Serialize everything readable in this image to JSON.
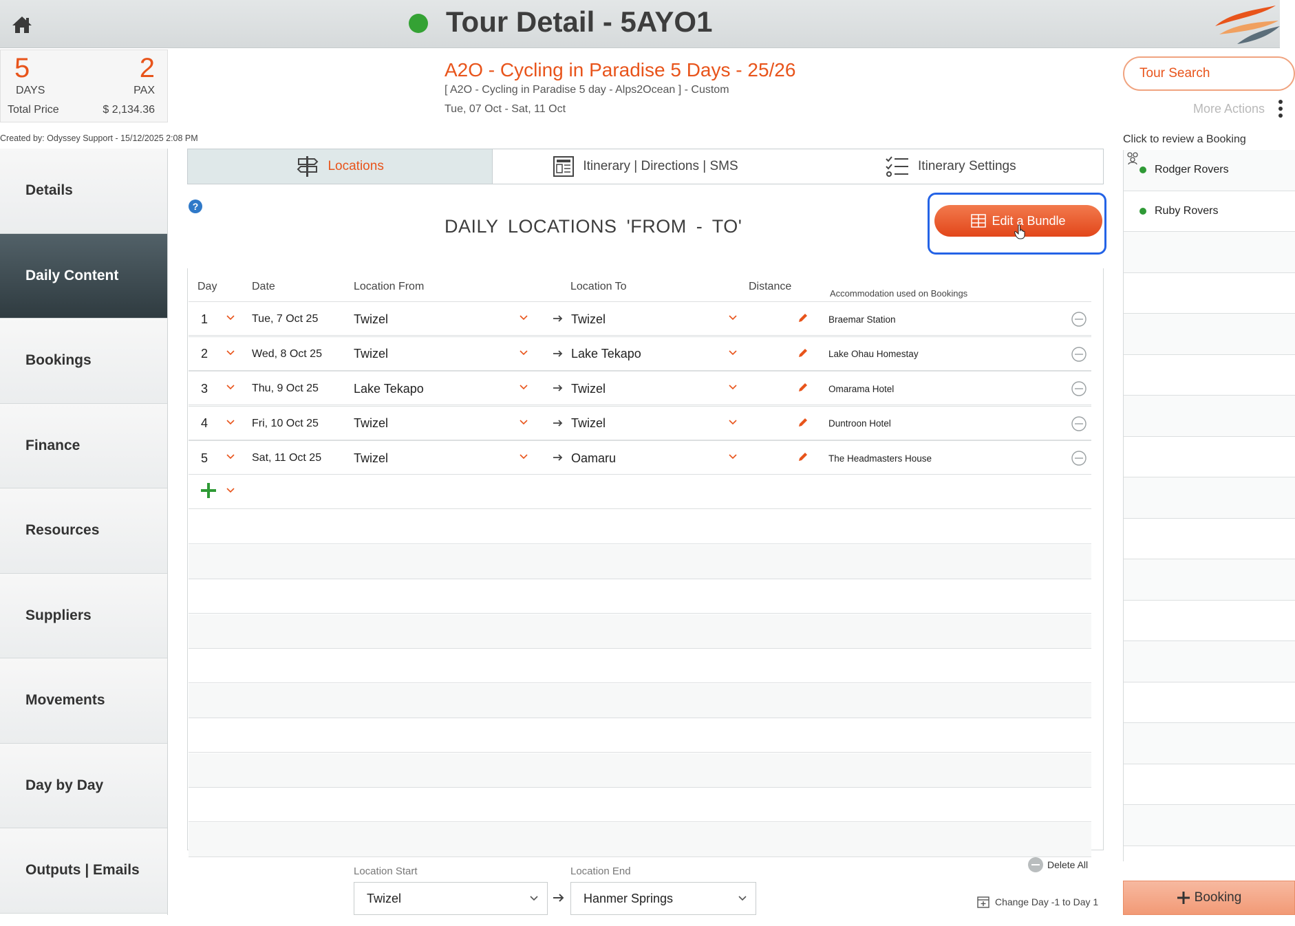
{
  "header": {
    "title": "Tour Detail - 5AYO1",
    "status_color": "#34a234"
  },
  "summary": {
    "days_value": "5",
    "days_label": "DAYS",
    "pax_value": "2",
    "pax_label": "PAX",
    "price_label": "Total Price",
    "price_value": "$ 2,134.36",
    "created": "Created by: Odyssey Support - 15/12/2025 2:08 PM"
  },
  "tour": {
    "title": "A2O - Cycling in Paradise 5 Days - 25/26",
    "subtitle": "[ A2O - Cycling in Paradise 5 day - Alps2Ocean ] - Custom",
    "dates": "Tue, 07 Oct  - Sat, 11 Oct"
  },
  "actions": {
    "tour_search": "Tour Search",
    "more_actions": "More Actions"
  },
  "sidebar": {
    "items": [
      {
        "label": "Details"
      },
      {
        "label": "Daily Content",
        "active": true
      },
      {
        "label": "Bookings"
      },
      {
        "label": "Finance"
      },
      {
        "label": "Resources"
      },
      {
        "label": "Suppliers"
      },
      {
        "label": "Movements"
      },
      {
        "label": "Day by Day"
      },
      {
        "label": "Outputs | Emails"
      }
    ]
  },
  "tabs": [
    {
      "label": "Locations",
      "icon": "signpost-icon",
      "active": true
    },
    {
      "label": "Itinerary | Directions | SMS",
      "icon": "document-icon"
    },
    {
      "label": "Itinerary Settings",
      "icon": "checklist-icon"
    }
  ],
  "main": {
    "section_title": "DAILY  LOCATIONS   'FROM - TO'",
    "bundle_button": "Edit a Bundle",
    "accent": "#e8541b",
    "columns": {
      "day": "Day",
      "date": "Date",
      "from": "Location From",
      "to": "Location To",
      "distance": "Distance",
      "accommodation": "Accommodation used on Bookings"
    },
    "rows": [
      {
        "day": "1",
        "date": "Tue, 7 Oct 25",
        "from": "Twizel",
        "to": "Twizel",
        "accommodation": "Braemar Station"
      },
      {
        "day": "2",
        "date": "Wed, 8 Oct 25",
        "from": "Twizel",
        "to": "Lake Tekapo",
        "accommodation": "Lake Ohau Homestay"
      },
      {
        "day": "3",
        "date": "Thu, 9 Oct 25",
        "from": "Lake Tekapo",
        "to": "Twizel",
        "accommodation": "Omarama Hotel"
      },
      {
        "day": "4",
        "date": "Fri, 10 Oct 25",
        "from": "Twizel",
        "to": "Twizel",
        "accommodation": "Duntroon Hotel"
      },
      {
        "day": "5",
        "date": "Sat, 11 Oct 25",
        "from": "Twizel",
        "to": "Oamaru",
        "accommodation": "The Headmasters House"
      }
    ]
  },
  "bottom": {
    "start_label": "Location Start",
    "start_value": "Twizel",
    "end_label": "Location End",
    "end_value": "Hanmer Springs",
    "delete_all": "Delete All",
    "change_day": "Change Day -1 to Day 1"
  },
  "right_panel": {
    "review_label": "Click to review a Booking",
    "bookings": [
      {
        "name": "Rodger Rovers"
      },
      {
        "name": "Ruby Rovers"
      }
    ],
    "add_booking": "Booking"
  }
}
